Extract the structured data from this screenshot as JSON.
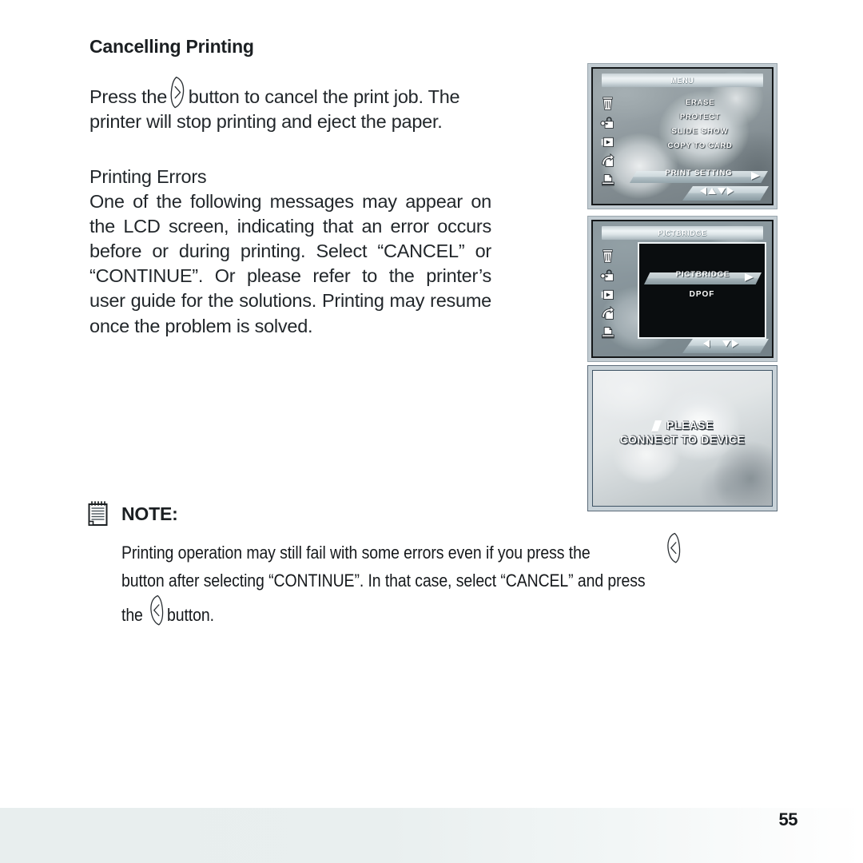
{
  "document": {
    "page_number": "55"
  },
  "section": {
    "heading": "Cancelling Printing",
    "paragraph_before_glyph": "Press the",
    "paragraph_after_glyph": "button to cancel the print job. The printer will stop printing and eject the paper.",
    "subheading": "Printing Errors",
    "body": "One of the following messages may appear on the LCD screen, indicating that an error occurs before or during printing. Select “CANCEL” or “CONTINUE”. Or please refer to the printer’s user guide for the solutions. Printing may resume once the problem is solved."
  },
  "note": {
    "icon": "notepad-icon",
    "label": "NOTE:",
    "line1_a": "Printing operation may still fail with some errors even if you press the",
    "line2": "button after selecting “CONTINUE”. In that case, select “CANCEL” and press",
    "line3_a": "the",
    "line3_b": "button."
  },
  "glyphs": {
    "right_button": "right-arrow-button-glyph",
    "left_button": "left-arrow-button-glyph"
  },
  "lcd_screens": [
    {
      "id": "menu-screen",
      "title": "MENU",
      "icons": [
        "trash-icon",
        "lock-key-icon",
        "slideshow-icon",
        "copy-to-card-icon",
        "printer-icon"
      ],
      "items": [
        "ERASE",
        "PROTECT",
        "SLIDE  SHOW",
        "COPY TO CARD"
      ],
      "selected_item": "PRINT SETTING",
      "selected_arrow": "right-triangle-icon",
      "navpad": [
        "left",
        "up",
        "down",
        "right"
      ]
    },
    {
      "id": "pictbridge-screen",
      "title": "PICTBRIDGE",
      "icons": [
        "trash-icon",
        "lock-key-icon",
        "slideshow-icon",
        "copy-to-card-icon",
        "printer-icon"
      ],
      "selected_item": "PICTBRIDGE",
      "selected_arrow": "right-triangle-icon",
      "items": [
        "DPOF"
      ],
      "navpad": [
        "left",
        "down",
        "right"
      ]
    },
    {
      "id": "connect-device-screen",
      "message_line1": "PLEASE",
      "message_line2": "CONNECT TO DEVICE",
      "message_icon": "slash-icon"
    }
  ],
  "colors": {
    "text": "#22272b",
    "heading": "#1b1f22",
    "lcd_frame": "#c2ccd2",
    "lcd_border": "#15181a",
    "footer_tint": "#e8eeee"
  }
}
